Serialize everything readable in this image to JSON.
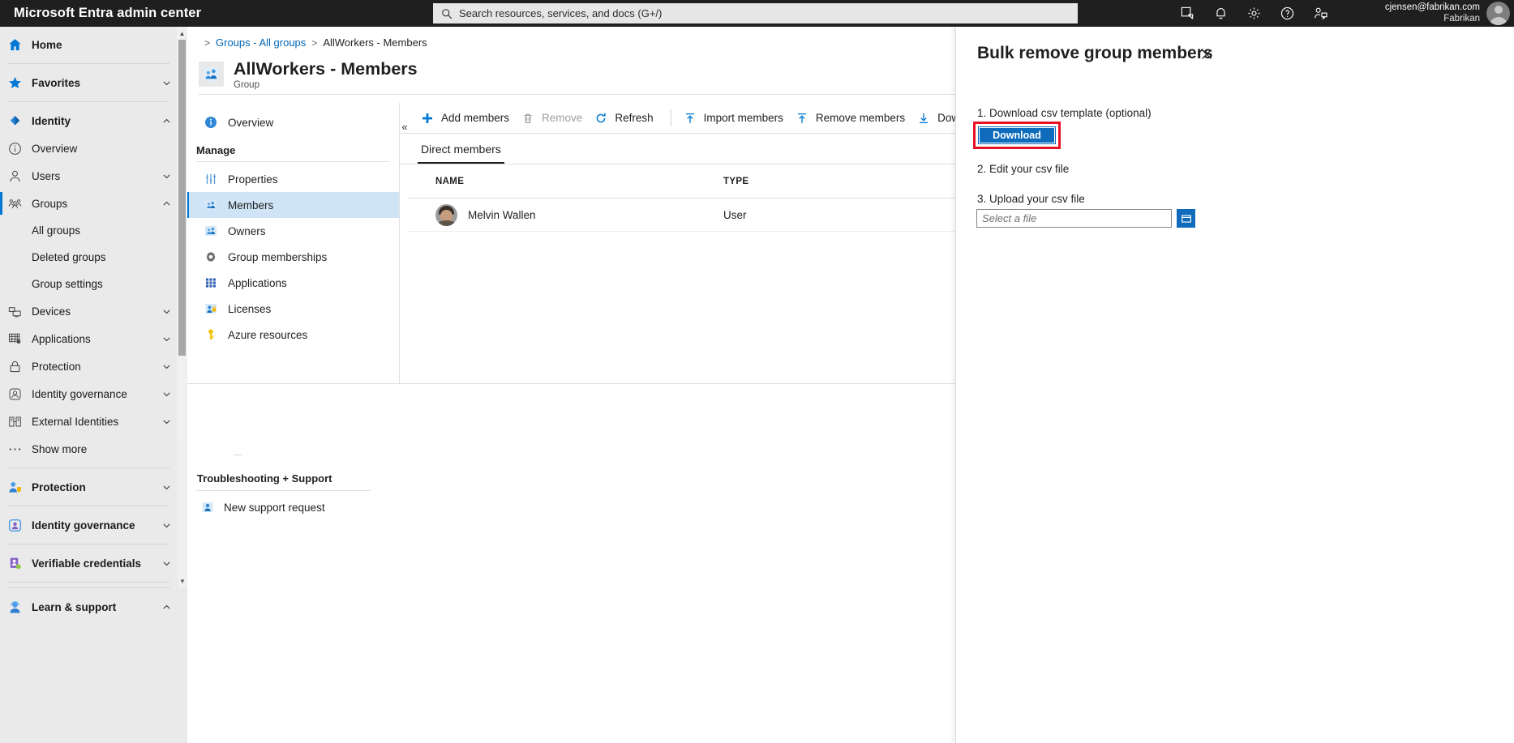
{
  "topbar": {
    "brand": "Microsoft Entra admin center",
    "search_placeholder": "Search resources, services, and docs (G+/)",
    "search_icon": "search-icon",
    "icons": [
      {
        "name": "cloud-shell-icon"
      },
      {
        "name": "notifications-bell-icon"
      },
      {
        "name": "settings-gear-icon"
      },
      {
        "name": "help-question-icon"
      },
      {
        "name": "feedback-person-icon"
      }
    ],
    "account_email": "cjensen@fabrikan.com",
    "account_org": "Fabrikan"
  },
  "leftnav": {
    "items": [
      {
        "label": "Home",
        "icon": "home-icon",
        "bold": true,
        "chevron": false,
        "sub": false,
        "selected": false
      },
      {
        "label": "Favorites",
        "icon": "star-icon",
        "bold": true,
        "chevron": true,
        "sub": false,
        "selected": false
      },
      {
        "label": "Identity",
        "icon": "identity-diamond-icon",
        "bold": true,
        "chevron": true,
        "sub": false,
        "selected": false
      },
      {
        "label": "Overview",
        "icon": "info-circle-icon",
        "bold": false,
        "chevron": false,
        "sub": false,
        "selected": false
      },
      {
        "label": "Users",
        "icon": "user-icon",
        "bold": false,
        "chevron": true,
        "sub": false,
        "selected": false
      },
      {
        "label": "Groups",
        "icon": "groups-icon",
        "bold": false,
        "chevron": true,
        "sub": false,
        "selected": true
      },
      {
        "label": "All groups",
        "icon": "",
        "bold": false,
        "chevron": false,
        "sub": true,
        "selected": false
      },
      {
        "label": "Deleted groups",
        "icon": "",
        "bold": false,
        "chevron": false,
        "sub": true,
        "selected": false
      },
      {
        "label": "Group settings",
        "icon": "",
        "bold": false,
        "chevron": false,
        "sub": true,
        "selected": false
      },
      {
        "label": "Devices",
        "icon": "devices-icon",
        "bold": false,
        "chevron": true,
        "sub": false,
        "selected": false
      },
      {
        "label": "Applications",
        "icon": "applications-grid-icon",
        "bold": false,
        "chevron": true,
        "sub": false,
        "selected": false
      },
      {
        "label": "Protection",
        "icon": "lock-icon",
        "bold": false,
        "chevron": true,
        "sub": false,
        "selected": false
      },
      {
        "label": "Identity governance",
        "icon": "governance-icon",
        "bold": false,
        "chevron": true,
        "sub": false,
        "selected": false
      },
      {
        "label": "External Identities",
        "icon": "external-identities-icon",
        "bold": false,
        "chevron": true,
        "sub": false,
        "selected": false
      },
      {
        "label": "Show more",
        "icon": "ellipsis-icon",
        "bold": false,
        "chevron": false,
        "sub": false,
        "selected": false
      }
    ],
    "bottom_items": [
      {
        "label": "Protection",
        "icon": "protection-shield-person-icon",
        "chevron": true
      },
      {
        "label": "Identity governance",
        "icon": "identity-governance-color-icon",
        "chevron": true
      },
      {
        "label": "Verifiable credentials",
        "icon": "verifiable-credentials-icon",
        "chevron": true
      },
      {
        "label": "Learn & support",
        "icon": "learn-support-icon",
        "chevron": true
      }
    ]
  },
  "breadcrumb": {
    "link": "Groups - All groups",
    "current": "AllWorkers - Members",
    "separator": ">"
  },
  "blade": {
    "title": "AllWorkers - Members",
    "subtitle": "Group",
    "icon": "group-members-icon",
    "collapse_icon": "double-chevron-left-icon"
  },
  "inner_menu": {
    "top_items": [
      {
        "label": "Overview",
        "icon": "info-circle-icon",
        "active": false
      }
    ],
    "group_label": "Manage",
    "items": [
      {
        "label": "Properties",
        "icon": "properties-sliders-icon",
        "active": false
      },
      {
        "label": "Members",
        "icon": "members-icon",
        "active": true
      },
      {
        "label": "Owners",
        "icon": "owners-icon",
        "active": false
      },
      {
        "label": "Group memberships",
        "icon": "gear-icon",
        "active": false
      },
      {
        "label": "Applications",
        "icon": "applications-grid-icon",
        "active": false
      },
      {
        "label": "Licenses",
        "icon": "licenses-icon",
        "active": false
      },
      {
        "label": "Azure resources",
        "icon": "key-icon",
        "active": false
      }
    ],
    "troubleshooting": {
      "title": "Troubleshooting + Support",
      "items": [
        {
          "label": "New support request",
          "icon": "support-person-icon"
        }
      ]
    }
  },
  "toolbar": {
    "buttons": [
      {
        "label": "Add members",
        "icon": "plus-icon",
        "disabled": false
      },
      {
        "label": "Remove",
        "icon": "trash-icon",
        "disabled": true
      },
      {
        "label": "Refresh",
        "icon": "refresh-icon",
        "disabled": false
      },
      {
        "label": "Import members",
        "icon": "upload-arrow-icon",
        "disabled": false
      },
      {
        "label": "Remove members",
        "icon": "upload-arrow-icon",
        "disabled": false
      },
      {
        "label": "Download members",
        "icon": "download-arrow-icon",
        "disabled": false
      }
    ]
  },
  "tabs": [
    {
      "label": "Direct members",
      "active": true
    }
  ],
  "table": {
    "columns": [
      "NAME",
      "TYPE"
    ],
    "rows": [
      {
        "name": "Melvin Wallen",
        "type": "User",
        "avatar": "user-photo-avatar"
      }
    ]
  },
  "panel": {
    "title": "Bulk remove group members",
    "close_icon": "close-x-icon",
    "step1_label": "1. Download csv template (optional)",
    "download_button": "Download",
    "step2_label": "2. Edit your csv file",
    "step3_label": "3. Upload your csv file",
    "file_placeholder": "Select a file",
    "browse_icon": "folder-browse-icon",
    "highlight_color": "#e81123",
    "accent_color": "#0f6cbd"
  }
}
